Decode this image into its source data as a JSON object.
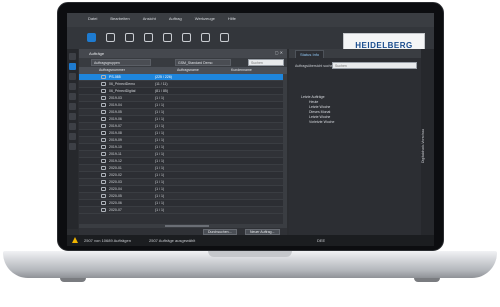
{
  "menu": [
    "Datei",
    "Bearbeiten",
    "Ansicht",
    "Auftrag",
    "Werkzeuge",
    "Hilfe"
  ],
  "toolbar": {
    "icons": [
      "jobs-icon",
      "folder-icon",
      "link-icon",
      "gear-icon",
      "user-icon",
      "print-icon",
      "chart-icon",
      "window-icon"
    ]
  },
  "logo": "HEIDELBERG",
  "panel": {
    "title": "Aufträge",
    "group_label": "Auftragsgruppen",
    "filter_value": "GSM_Standard Demo",
    "search_placeholder": "Suchen",
    "columns": [
      "Auftragsnummer",
      "Auftragsname",
      "Kundenname"
    ],
    "rows": [
      {
        "num": "PS-085",
        "count": "(225 / 226)",
        "selected": true
      },
      {
        "num": "06_PrinectDemo",
        "count": "(11 / 11)"
      },
      {
        "num": "06_PrinectDigital",
        "count": "(81 / 85)"
      },
      {
        "num": "2019-03",
        "count": "(1 / 1)"
      },
      {
        "num": "2019-04",
        "count": "(1 / 1)"
      },
      {
        "num": "2019-05",
        "count": "(1 / 1)"
      },
      {
        "num": "2019-06",
        "count": "(1 / 1)"
      },
      {
        "num": "2019-07",
        "count": "(1 / 1)"
      },
      {
        "num": "2019-08",
        "count": "(1 / 1)"
      },
      {
        "num": "2019-09",
        "count": "(1 / 1)"
      },
      {
        "num": "2019-10",
        "count": "(1 / 1)"
      },
      {
        "num": "2019-11",
        "count": "(1 / 1)"
      },
      {
        "num": "2019-12",
        "count": "(1 / 1)"
      },
      {
        "num": "2020-01",
        "count": "(1 / 1)"
      },
      {
        "num": "2020-02",
        "count": "(1 / 1)"
      },
      {
        "num": "2020-03",
        "count": "(1 / 1)"
      },
      {
        "num": "2020-04",
        "count": "(1 / 1)"
      },
      {
        "num": "2020-05",
        "count": "(1 / 1)"
      },
      {
        "num": "2020-06",
        "count": "(1 / 1)"
      },
      {
        "num": "2020-07",
        "count": "(1 / 1)"
      }
    ],
    "buttons": [
      "Durchsuchen...",
      "Neuer Auftrag..."
    ]
  },
  "right": {
    "tab": "Status Info",
    "search_label": "Auftragsübersicht suchen:",
    "search_placeholder": "Suchen",
    "tree": [
      "Letzte Aufträge",
      "Heute",
      "Letzte Woche",
      "Dieses Monat",
      "Letzte Woche",
      "Vorletzte Woche"
    ],
    "side_label": "Digitaldruck-Vorschau"
  },
  "status": {
    "left": "2507 von 10689 Aufträgen",
    "mid": "2507 Aufträge ausgewählt",
    "right": "DEE"
  }
}
